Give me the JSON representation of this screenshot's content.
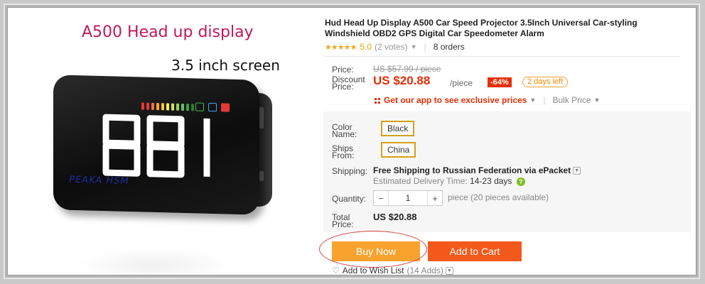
{
  "image": {
    "title": "A500 Head up display",
    "subtitle": "3.5 inch screen",
    "speed_display": "881",
    "device_logo": "PEAKA HSM"
  },
  "product": {
    "title": "Hud Head Up Display A500 Car Speed Projector 3.5Inch Universal Car-styling Windshield OBD2 GPS Digital Car Speedometer Alarm",
    "rating": "5.0",
    "votes": "(2 votes)",
    "orders": "8 orders"
  },
  "price": {
    "price_label": "Price:",
    "original": "US $57.99 / piece",
    "discount_label": "Discount Price:",
    "discount_value": "US $20.88",
    "per_piece": "/piece",
    "off": "-64%",
    "days_left": "2 days left",
    "app_promo": "Get our app to see exclusive prices",
    "bulk": "Bulk Price"
  },
  "options": {
    "color_label": "Color Name:",
    "color_value": "Black",
    "ships_label": "Ships From:",
    "ships_value": "China"
  },
  "shipping": {
    "label": "Shipping:",
    "method": "Free Shipping to Russian Federation via ePacket",
    "estimate_label": "Estimated Delivery Time:",
    "estimate_days": "14-23 days"
  },
  "quantity": {
    "label": "Quantity:",
    "value": "1",
    "minus": "−",
    "plus": "+",
    "available": "piece (20 pieces available)"
  },
  "total": {
    "label": "Total Price:",
    "value": "US $20.88"
  },
  "actions": {
    "buy_now": "Buy Now",
    "add_to_cart": "Add to Cart",
    "wishlist": "Add to Wish List",
    "wishlist_count": "(14 Adds)"
  },
  "colors": {
    "price_red": "#e62e04",
    "buy_orange": "#f8a32e",
    "cart_orange": "#f3591a",
    "star_gold": "#f5a623"
  }
}
